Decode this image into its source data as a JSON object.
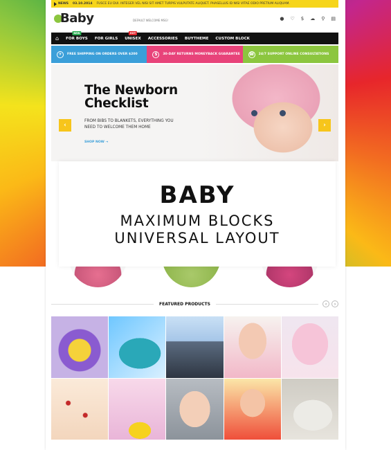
{
  "newsbar": {
    "tag": "NEWS",
    "date": "03.10.2014",
    "text": "FUSCE EU DUI. INTEGER VEL NISI SIT AMET TURPIS VULPUTATE ALIQUET. PHASELLUS ID NISI VITAE ODIO PRETIUM ALIQUAM."
  },
  "header": {
    "logo": "Baby",
    "welcome": "DEFAULT WELCOME MSG!",
    "icons": [
      "user-icon",
      "heart-icon",
      "dollar-icon",
      "cloud-icon",
      "search-icon",
      "cart-icon"
    ]
  },
  "nav": {
    "items": [
      {
        "label": "FOR BOYS",
        "badge": "NEW"
      },
      {
        "label": "FOR GIRLS",
        "badge": ""
      },
      {
        "label": "UNISEX",
        "badge": "HOT"
      },
      {
        "label": "ACCESSORIES",
        "badge": ""
      },
      {
        "label": "BUYTHEME",
        "badge": ""
      },
      {
        "label": "CUSTOM BLOCK",
        "badge": ""
      }
    ]
  },
  "promo": {
    "shipping": "FREE SHIPPING ON ORDERS OVER $200",
    "returns": "30-DAY RETURNS MONEYBACK GUARANTEE",
    "support": "24/7 SUPPORT ONLINE CONSULTATIONS",
    "colors": {
      "blue": "#3b9fd9",
      "pink": "#e8437a",
      "green": "#8cc63f"
    }
  },
  "hero": {
    "headline_line1": "The Newborn",
    "headline_line2": "Checklist",
    "sub_line1": "FROM BIBS TO BLANKETS, EVERYTHING YOU",
    "sub_line2": "NEED TO WELCOME THEM HOME",
    "cta": "SHOP NOW ⇢"
  },
  "overlay": {
    "title": "BABY",
    "line1": "MAXIMUM BLOCKS",
    "line2": "UNIVERSAL LAYOUT"
  },
  "featured": {
    "label": "FEATURED PRODUCTS"
  }
}
